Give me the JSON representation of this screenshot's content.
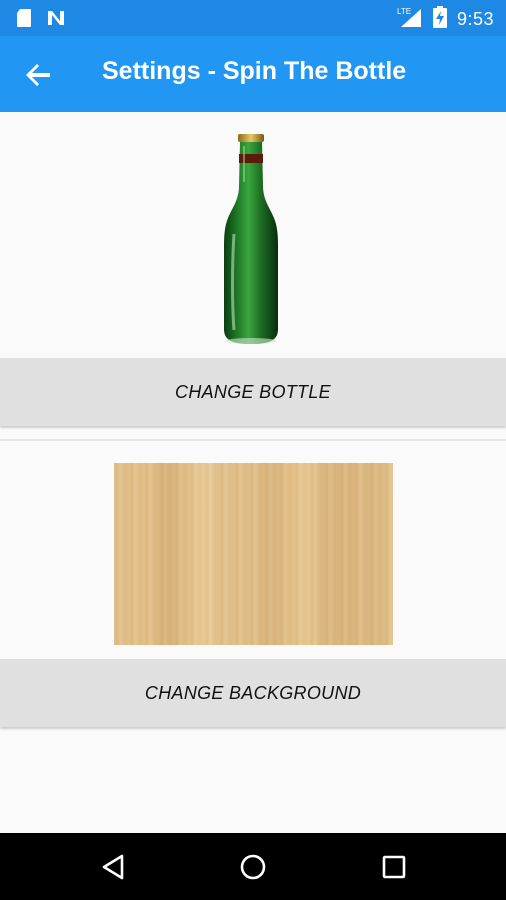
{
  "status_bar": {
    "time": "9:53",
    "network": "LTE",
    "icons": [
      "sd-card-icon",
      "n-notification-icon",
      "lte-signal-icon",
      "battery-charging-icon"
    ]
  },
  "app_bar": {
    "title": "Settings - Spin The Bottle",
    "back_icon": "arrow-left-icon"
  },
  "bottle_section": {
    "image": "green-beer-bottle",
    "button_label": "CHANGE BOTTLE"
  },
  "background_section": {
    "image": "light-wood-texture",
    "button_label": "CHANGE BACKGROUND"
  },
  "nav_bar": {
    "icons": [
      "back-triangle-icon",
      "home-circle-icon",
      "recents-square-icon"
    ]
  },
  "colors": {
    "status_bar": "#1e88e5",
    "app_bar": "#2196f3",
    "button_bg": "#e0e0e0",
    "page_bg": "#fafafa",
    "nav_bar": "#000000"
  }
}
